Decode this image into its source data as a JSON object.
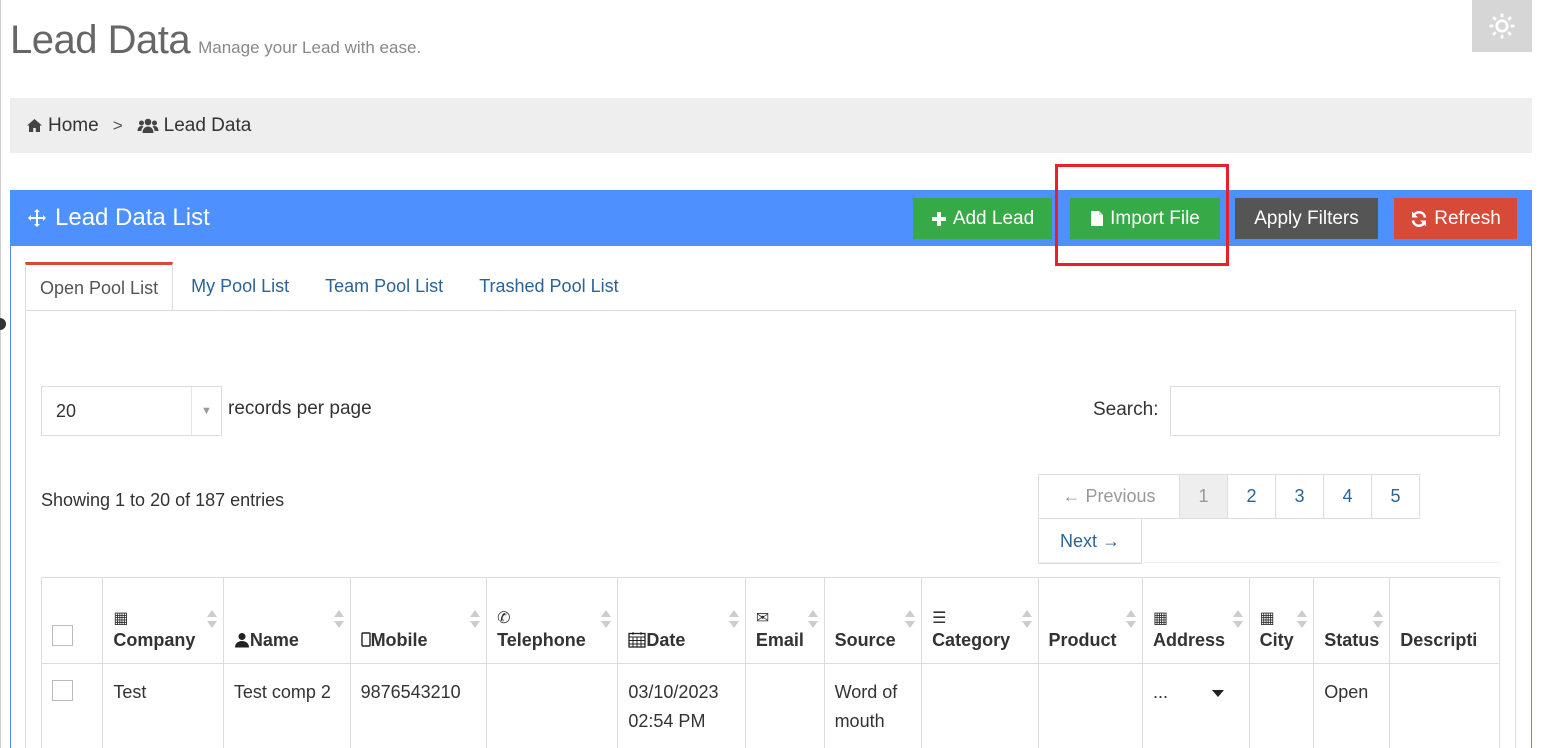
{
  "page": {
    "title": "Lead Data",
    "subtitle": "Manage your Lead with ease."
  },
  "breadcrumb": {
    "home_label": "Home",
    "current_label": "Lead Data",
    "separator": ">"
  },
  "panel": {
    "title": "Lead Data List",
    "buttons": {
      "add_lead": "Add Lead",
      "import_file": "Import File",
      "apply_filters": "Apply Filters",
      "refresh": "Refresh"
    }
  },
  "tabs": [
    "Open Pool List",
    "My Pool List",
    "Team Pool List",
    "Trashed Pool List"
  ],
  "active_tab": "Open Pool List",
  "length_menu": {
    "selected": "20",
    "label": "records per page"
  },
  "search": {
    "label": "Search:",
    "value": ""
  },
  "info_text": "Showing 1 to 20 of 187 entries",
  "pagination": {
    "previous": "← Previous",
    "pages": [
      "1",
      "2",
      "3",
      "4",
      "5"
    ],
    "current_page": "1",
    "next": "Next →"
  },
  "table": {
    "columns": [
      {
        "label": "Company",
        "icon": "building-icon",
        "glyph": "▦"
      },
      {
        "label": "Name",
        "icon": "user-icon",
        "glyph": ""
      },
      {
        "label": "Mobile",
        "icon": "mobile-icon",
        "glyph": ""
      },
      {
        "label": "Telephone",
        "icon": "phone-icon",
        "glyph": "✆"
      },
      {
        "label": "Date",
        "icon": "calendar-icon",
        "glyph": ""
      },
      {
        "label": "Email",
        "icon": "envelope-icon",
        "glyph": "✉"
      },
      {
        "label": "Source",
        "icon": "",
        "glyph": ""
      },
      {
        "label": "Category",
        "icon": "list-icon",
        "glyph": "☰"
      },
      {
        "label": "Product",
        "icon": "",
        "glyph": ""
      },
      {
        "label": "Address",
        "icon": "building-icon",
        "glyph": "▦"
      },
      {
        "label": "City",
        "icon": "building-icon",
        "glyph": "▦"
      },
      {
        "label": "Status",
        "icon": "",
        "glyph": ""
      },
      {
        "label": "Descripti",
        "icon": "",
        "glyph": ""
      }
    ],
    "rows": [
      {
        "company": "Test",
        "name": "Test comp 2",
        "mobile": "9876543210",
        "telephone": "",
        "date": "03/10/2023 02:54 PM",
        "email": "",
        "source": "Word of mouth",
        "category": "",
        "product": "",
        "address": "...",
        "city": "",
        "status": "Open",
        "description": ""
      }
    ]
  },
  "colors": {
    "panel_header": "#4d90fe",
    "green_button": "#35aa47",
    "dark_button": "#555555",
    "red_button": "#d84a38",
    "highlight_box": "#e8202a",
    "date_text": "#e0302c",
    "link": "#2a6496"
  }
}
